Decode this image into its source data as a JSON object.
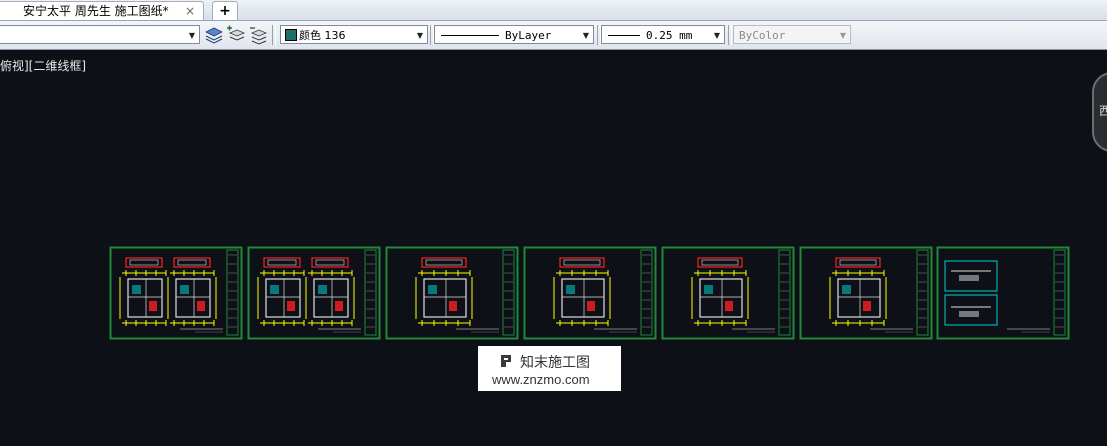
{
  "tabs": {
    "document_title": "安宁太平 周先生   施工图纸*",
    "close_glyph": "×",
    "add_glyph": "+"
  },
  "toolbar": {
    "layer_value": "",
    "color_label": "颜色 136",
    "color_swatch": "#1f6e6e",
    "linetype_label": "ByLayer",
    "lineweight_label": "0.25 mm",
    "plotstyle_label": "ByColor",
    "dropdown_arrow": "▼"
  },
  "viewport": {
    "label": "俯视][二维线框]",
    "viewcube_label": "西",
    "background": "#0d1017"
  },
  "drawing_sheets": [
    {
      "name": "sheet-1"
    },
    {
      "name": "sheet-2"
    },
    {
      "name": "sheet-3"
    },
    {
      "name": "sheet-4"
    },
    {
      "name": "sheet-5"
    },
    {
      "name": "sheet-6"
    },
    {
      "name": "sheet-7"
    }
  ],
  "watermark": {
    "title": "知末施工图",
    "url": "www.znzmo.com"
  },
  "colors": {
    "sheet_border": "#1f8a3a",
    "drawing_yellow": "#ffff00",
    "drawing_red": "#ff2020",
    "drawing_white": "#e0e0e0",
    "drawing_cyan": "#00d0d0"
  }
}
